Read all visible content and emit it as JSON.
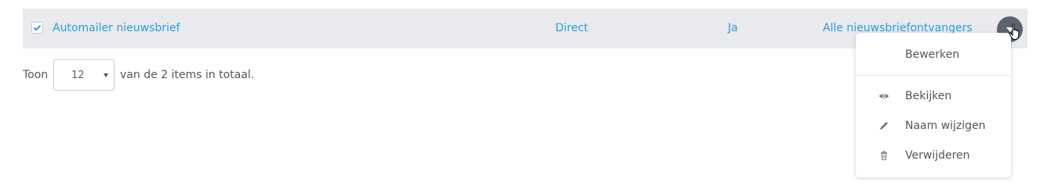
{
  "row": {
    "checked": true,
    "name": "Automailer nieuwsbrief",
    "timing": "Direct",
    "active": "Ja",
    "recipients": "Alle nieuwsbriefontvangers"
  },
  "pager": {
    "prefix": "Toon",
    "page_size": "12",
    "suffix": "van de 2 items in totaal."
  },
  "menu": {
    "items": [
      {
        "label": "Bewerken",
        "icon": ""
      },
      {
        "label": "Bekijken",
        "icon": "eye-icon"
      },
      {
        "label": "Naam wijzigen",
        "icon": "pencil-icon"
      },
      {
        "label": "Verwijderen",
        "icon": "trash-icon"
      }
    ]
  },
  "colors": {
    "link": "#2b9fd8",
    "row_bg": "#e8eaee",
    "action_button": "#5c6470"
  }
}
